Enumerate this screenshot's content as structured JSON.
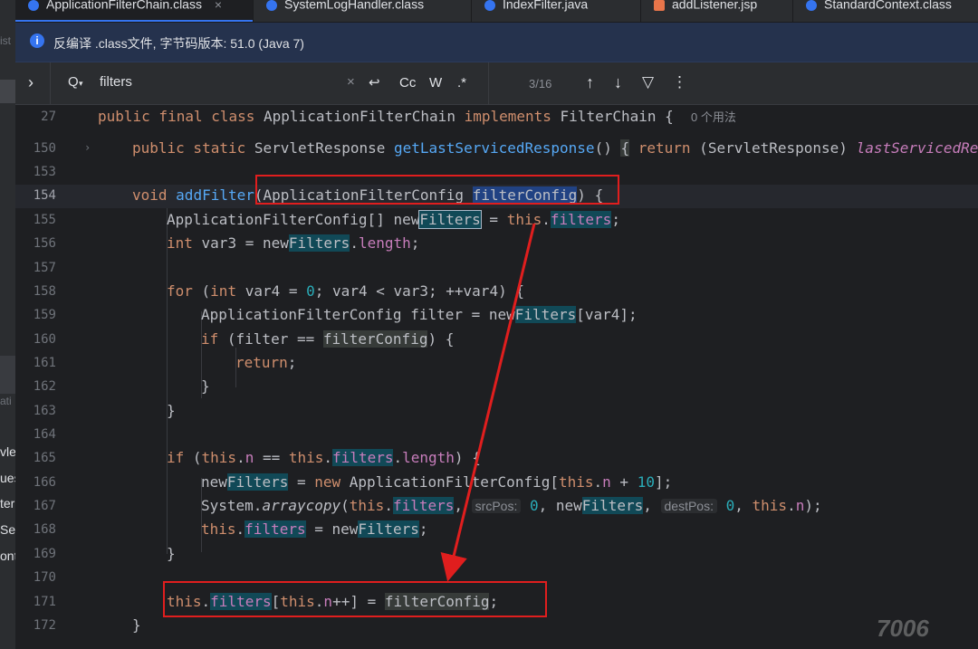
{
  "tabs": [
    {
      "label": "ApplicationFilterChain.class",
      "icon": "class-file-icon",
      "close": "×",
      "active": true
    },
    {
      "label": "SystemLogHandler.class",
      "icon": "class-file-icon"
    },
    {
      "label": "IndexFilter.java",
      "icon": "java-file-icon"
    },
    {
      "label": "addListener.jsp",
      "icon": "jsp-file-icon"
    },
    {
      "label": "StandardContext.class",
      "icon": "class-file-icon"
    }
  ],
  "left_panel_fragments": [
    "ist",
    "ati",
    "vle",
    "ues",
    "ter",
    "Se",
    "ont"
  ],
  "banner": {
    "icon": "info-icon",
    "icon_glyph": "i",
    "text": "反编译 .class文件, 字节码版本: 51.0 (Java 7)"
  },
  "search": {
    "expand": "›",
    "search_icon_glyph": "Q",
    "query": "filters",
    "clear": "×",
    "newline_glyph": "↩",
    "match_case": "Cc",
    "whole_word": "W",
    "regex": ".*",
    "counter": "3/16",
    "prev": "↑",
    "next": "↓",
    "filter_glyph": "▽",
    "more": "⋮"
  },
  "editor": {
    "line_numbers": [
      "27",
      "150",
      "153",
      "154",
      "155",
      "156",
      "157",
      "158",
      "159",
      "160",
      "161",
      "162",
      "163",
      "164",
      "165",
      "166",
      "167",
      "168",
      "169",
      "170",
      "171",
      "172"
    ],
    "header_usages": "0 个用法",
    "hints": {
      "src_pos": "srcPos:",
      "dest_pos": "destPos:"
    },
    "watermark": "7006"
  },
  "colors": {
    "annotation_box": "#e01e1e",
    "arrow": "#e01e1e",
    "match_bg": "#114957",
    "selection_bg": "#214283",
    "accent": "#3574f0"
  }
}
